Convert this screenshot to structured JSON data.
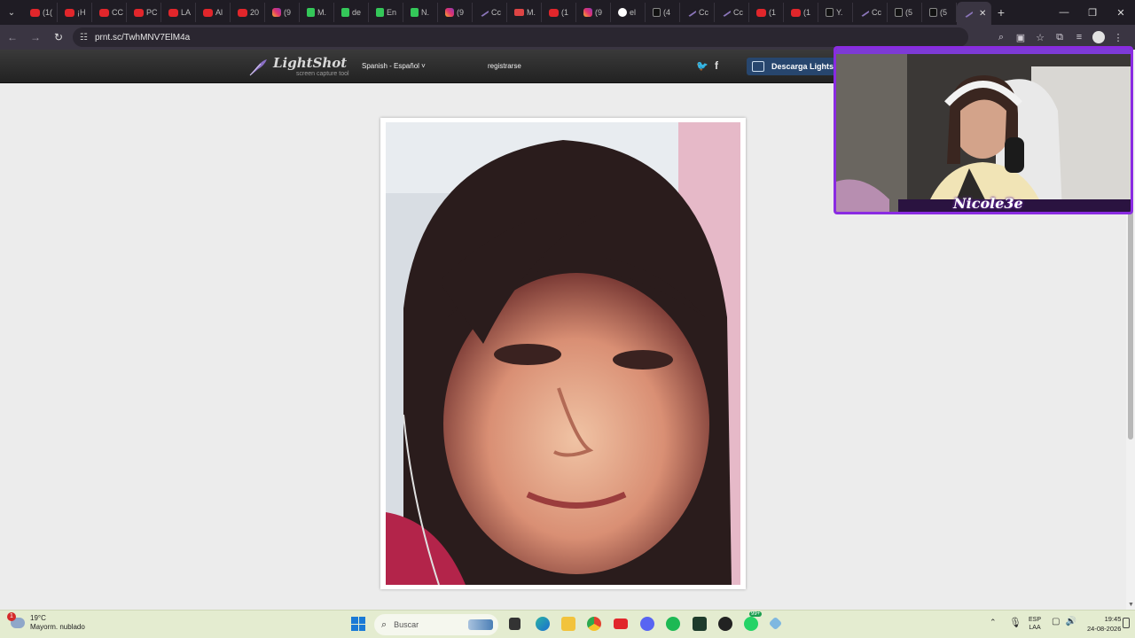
{
  "browser": {
    "tabs": [
      {
        "icon": "youtube-icon",
        "label": "(1("
      },
      {
        "icon": "youtube-icon",
        "label": "¡H"
      },
      {
        "icon": "youtube-icon",
        "label": "CC"
      },
      {
        "icon": "youtube-icon",
        "label": "PC"
      },
      {
        "icon": "youtube-icon",
        "label": "LA"
      },
      {
        "icon": "youtube-icon",
        "label": "Al"
      },
      {
        "icon": "youtube-icon",
        "label": "20"
      },
      {
        "icon": "instagram-icon",
        "label": "(9"
      },
      {
        "icon": "kick-icon",
        "label": "M."
      },
      {
        "icon": "kick-icon",
        "label": "de"
      },
      {
        "icon": "kick-icon",
        "label": "En"
      },
      {
        "icon": "kick-icon",
        "label": "N."
      },
      {
        "icon": "instagram-icon",
        "label": "(9"
      },
      {
        "icon": "lightshot-icon",
        "label": "Cc"
      },
      {
        "icon": "gmail-icon",
        "label": "M."
      },
      {
        "icon": "youtube-icon",
        "label": "(1"
      },
      {
        "icon": "instagram-icon",
        "label": "(9"
      },
      {
        "icon": "google-icon",
        "label": "el"
      },
      {
        "icon": "tiktok-icon",
        "label": "(4"
      },
      {
        "icon": "lightshot-icon",
        "label": "Cc"
      },
      {
        "icon": "lightshot-icon",
        "label": "Cc"
      },
      {
        "icon": "youtube-icon",
        "label": "(1"
      },
      {
        "icon": "youtube-icon",
        "label": "(1"
      },
      {
        "icon": "tiktok-icon",
        "label": "Y."
      },
      {
        "icon": "lightshot-icon",
        "label": "Cc"
      },
      {
        "icon": "tiktok-icon",
        "label": "(5"
      },
      {
        "icon": "tiktok-icon",
        "label": "(5"
      }
    ],
    "active_tab_close": "✕",
    "new_tab": "+",
    "url": "prnt.sc/TwhMNV7ElM4a",
    "window_minimize": "—",
    "window_maximize": "❐",
    "window_close": "✕"
  },
  "lightshot": {
    "brand": "LightShot",
    "tagline": "screen capture tool",
    "language": "Spanish - Español",
    "signup": "registrarse",
    "twitter_glyph": "🐦",
    "facebook_glyph": "f",
    "download_label": "Descarga Lights"
  },
  "overlay": {
    "streamer_name": "Nicole3e"
  },
  "taskbar": {
    "weather_temp": "19°C",
    "weather_desc": "Mayorm. nublado",
    "weather_badge": "1",
    "search_placeholder": "Buscar",
    "lang_top": "ESP",
    "lang_bottom": "LAA",
    "time": "19:45",
    "date": "24-08-2026",
    "whatsapp_badge": "99+"
  },
  "colors": {
    "overlay_border": "#8a2be2",
    "download_button": "#27466e"
  }
}
